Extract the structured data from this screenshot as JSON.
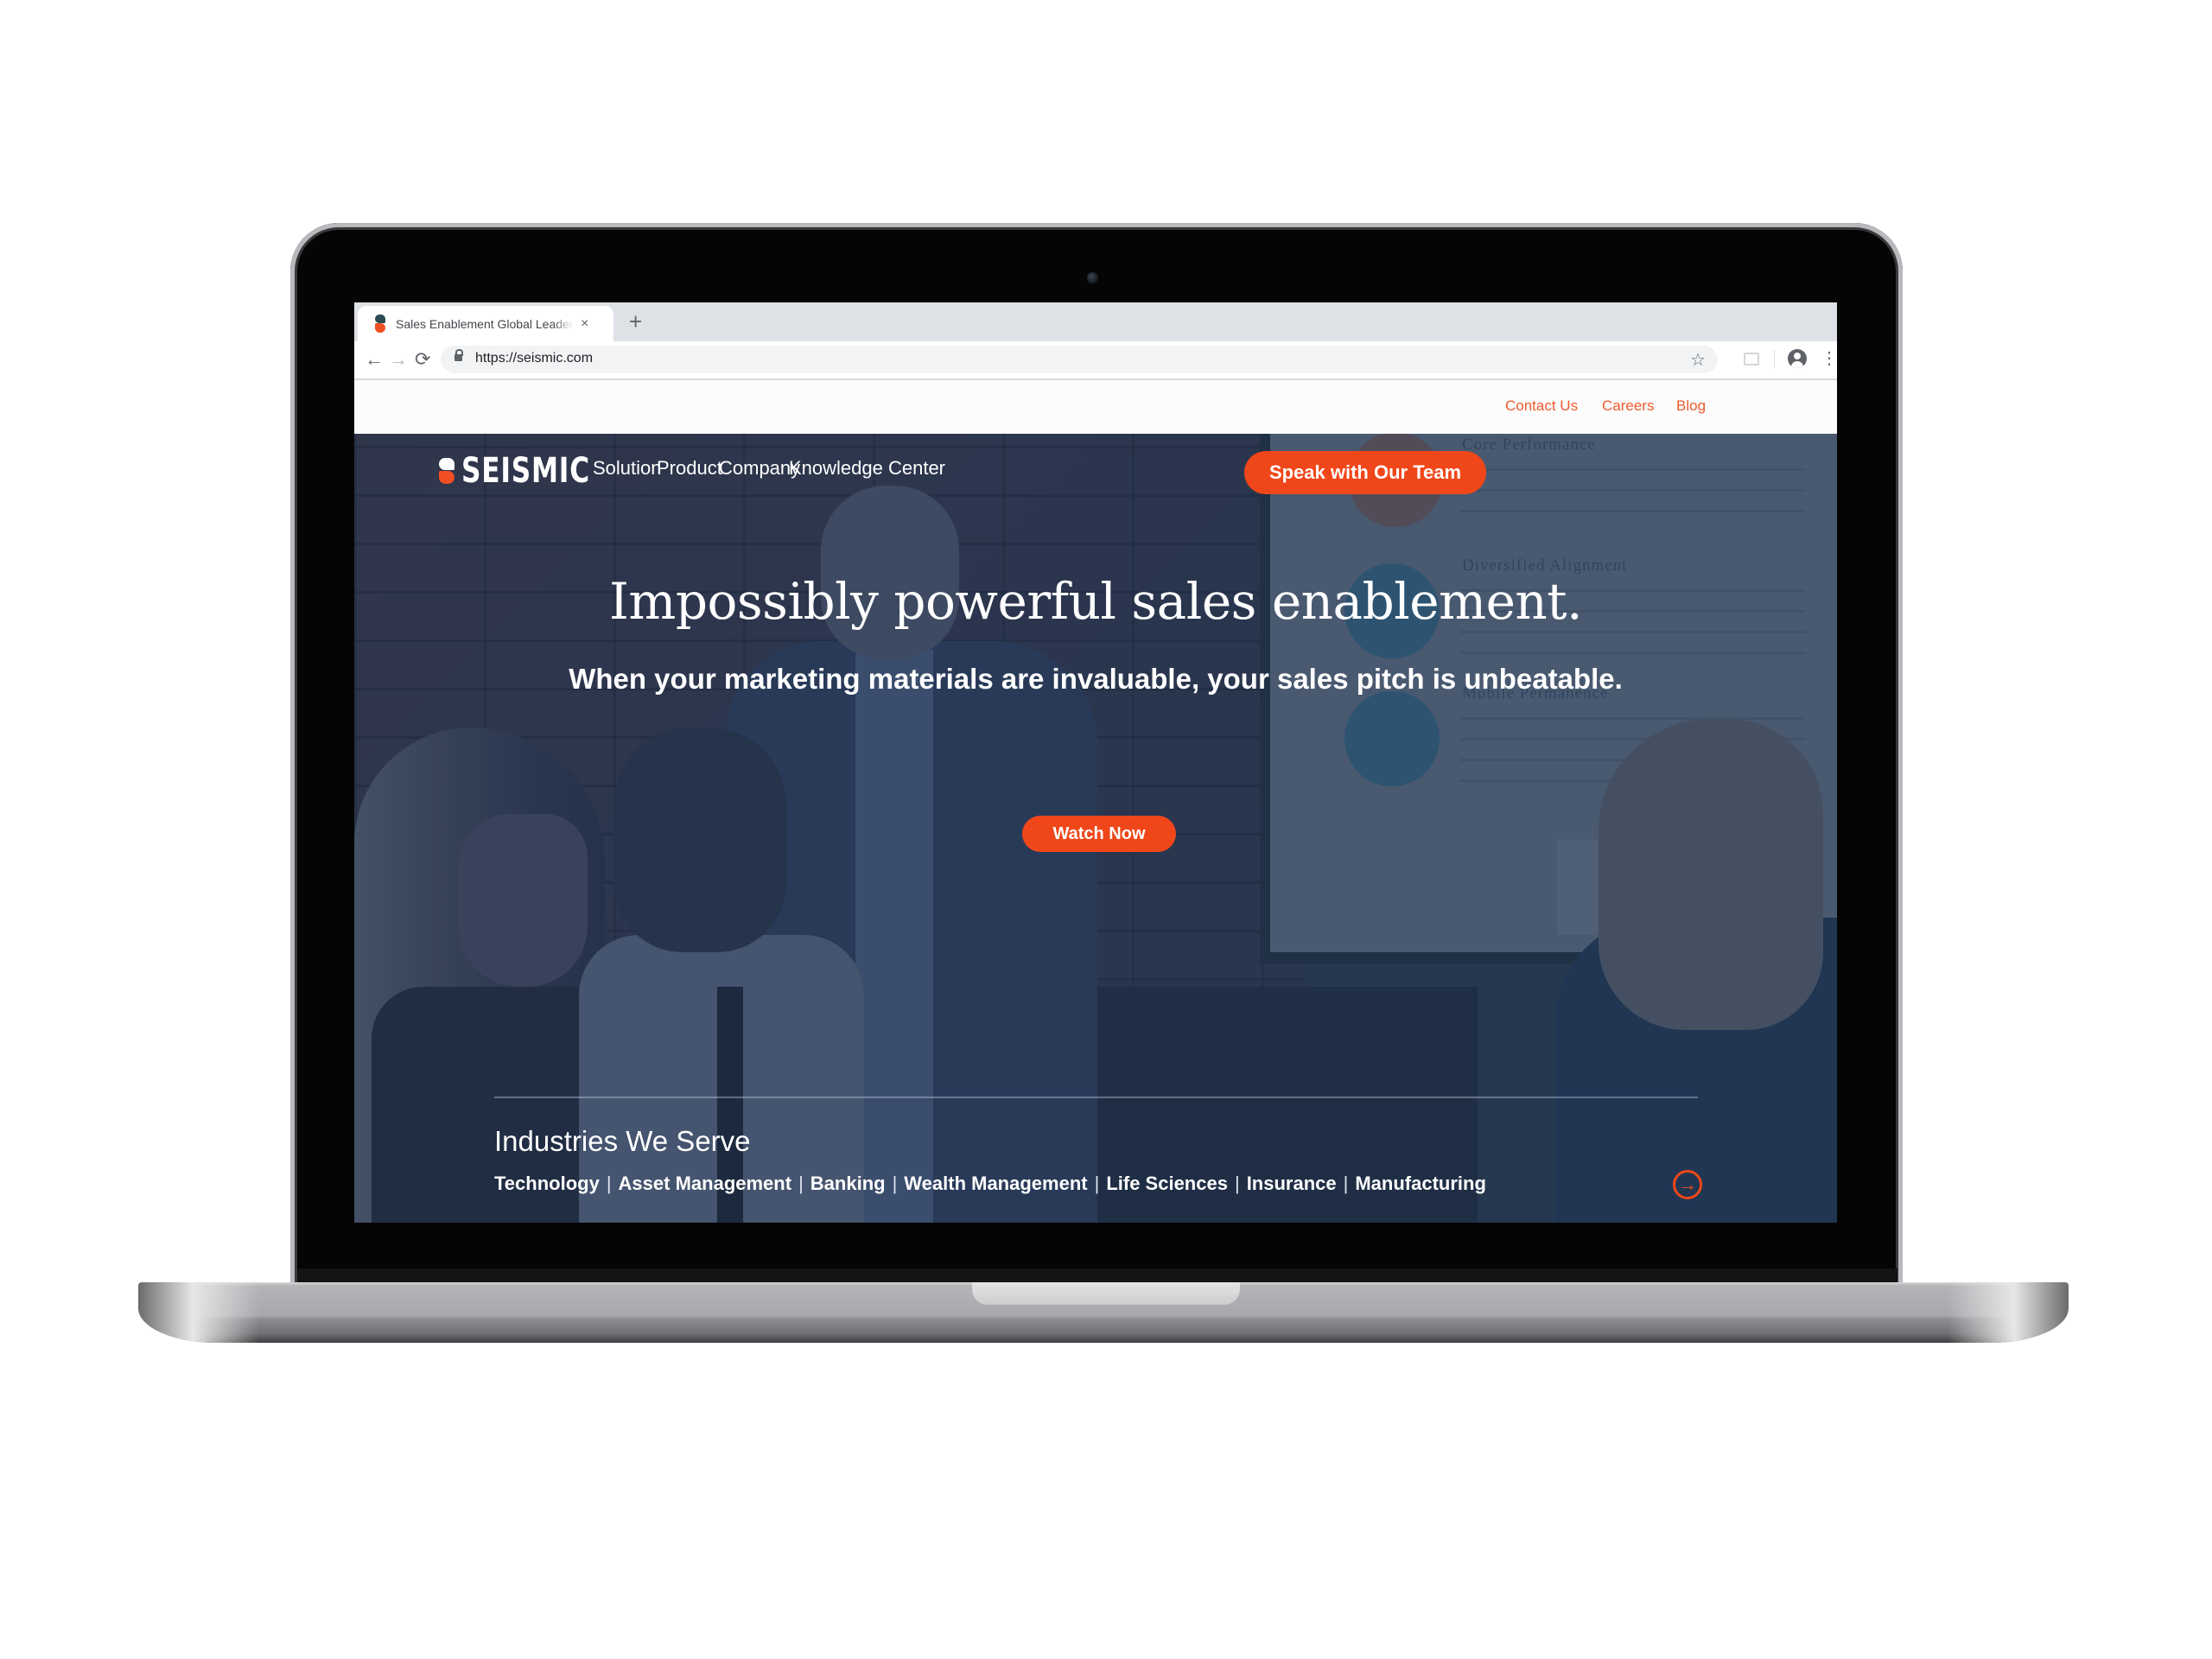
{
  "browser": {
    "tab_title": "Sales Enablement Global Leader",
    "tab_close_icon": "×",
    "new_tab_icon": "+",
    "back_icon": "←",
    "forward_icon": "→",
    "reload_icon": "⟳",
    "url": "https://seismic.com",
    "bookmark_icon": "☆",
    "menu_icon": "⋮"
  },
  "utility_nav": {
    "links": [
      "Contact Us",
      "Careers",
      "Blog"
    ]
  },
  "site": {
    "logo_text": "SEISMIC",
    "nav": [
      "Solution",
      "Product",
      "Company",
      "Knowledge Center"
    ],
    "cta_primary": "Speak with Our Team",
    "accent_color": "#f0471a"
  },
  "hero": {
    "headline": "Impossibly powerful sales enablement.",
    "subheadline": "When your marketing materials are invaluable, your sales pitch is unbeatable.",
    "cta": "Watch Now",
    "background_slide_headings": [
      "Core Performance",
      "Diversified Alignment",
      "Mobile Permanence"
    ]
  },
  "industries": {
    "title": "Industries We Serve",
    "items": [
      "Technology",
      "Asset Management",
      "Banking",
      "Wealth Management",
      "Life Sciences",
      "Insurance",
      "Manufacturing"
    ],
    "separator": "|",
    "next_icon": "→"
  }
}
